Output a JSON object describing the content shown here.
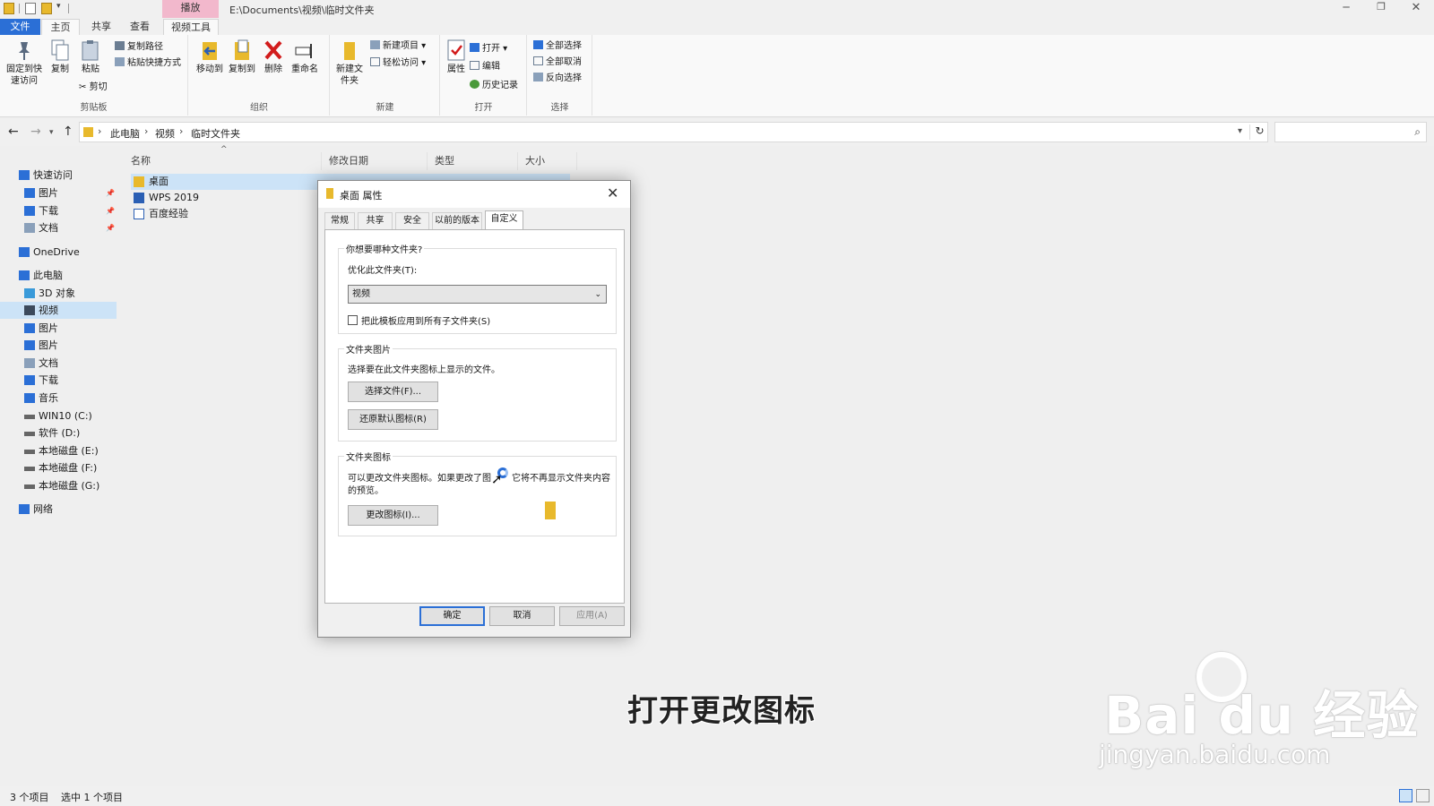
{
  "window": {
    "path_title": "E:\\Documents\\视频\\临时文件夹",
    "context_tab": "播放",
    "minimize": "─",
    "maximize": "❐",
    "close": "✕"
  },
  "ribbon_tabs": [
    "文件",
    "主页",
    "共享",
    "查看",
    "视频工具"
  ],
  "ribbon": {
    "clipboard": {
      "pin": "固定到快速访问",
      "copy": "复制",
      "paste": "粘贴",
      "copy_path": "复制路径",
      "paste_shortcut": "粘贴快捷方式",
      "cut": "剪切",
      "label": "剪贴板"
    },
    "organize": {
      "move_to": "移动到",
      "copy_to": "复制到",
      "delete": "删除",
      "rename": "重命名",
      "label": "组织"
    },
    "new": {
      "new_folder": "新建文件夹",
      "new_item": "新建项目",
      "easy_access": "轻松访问",
      "label": "新建"
    },
    "open": {
      "properties": "属性",
      "open": "打开",
      "edit": "编辑",
      "history": "历史记录",
      "label": "打开"
    },
    "select": {
      "select_all": "全部选择",
      "select_none": "全部取消",
      "invert": "反向选择",
      "label": "选择"
    }
  },
  "address": {
    "crumbs": [
      "此电脑",
      "视频",
      "临时文件夹"
    ]
  },
  "nav_tree": [
    {
      "label": "快速访问",
      "icon": "star-icon",
      "pinned": false
    },
    {
      "label": "图片",
      "icon": "pictures-icon",
      "pinned": true
    },
    {
      "label": "下载",
      "icon": "download-icon",
      "pinned": true
    },
    {
      "label": "文档",
      "icon": "document-icon",
      "pinned": true
    },
    {
      "label": "OneDrive",
      "icon": "cloud-icon",
      "pinned": false
    },
    {
      "label": "此电脑",
      "icon": "computer-icon",
      "pinned": false
    },
    {
      "label": "3D 对象",
      "icon": "cube-icon",
      "pinned": false
    },
    {
      "label": "视频",
      "icon": "video-icon",
      "pinned": false,
      "selected": true
    },
    {
      "label": "图片",
      "icon": "pictures-icon",
      "pinned": false
    },
    {
      "label": "图片",
      "icon": "pictures-icon",
      "pinned": false
    },
    {
      "label": "文档",
      "icon": "document-icon",
      "pinned": false
    },
    {
      "label": "下载",
      "icon": "download-icon",
      "pinned": false
    },
    {
      "label": "音乐",
      "icon": "music-icon",
      "pinned": false
    },
    {
      "label": "WIN10 (C:)",
      "icon": "drive-icon",
      "pinned": false
    },
    {
      "label": "软件 (D:)",
      "icon": "drive-icon",
      "pinned": false
    },
    {
      "label": "本地磁盘 (E:)",
      "icon": "drive-icon",
      "pinned": false
    },
    {
      "label": "本地磁盘 (F:)",
      "icon": "drive-icon",
      "pinned": false
    },
    {
      "label": "本地磁盘 (G:)",
      "icon": "drive-icon",
      "pinned": false
    },
    {
      "label": "网络",
      "icon": "network-icon",
      "pinned": false
    }
  ],
  "files": {
    "columns": [
      "名称",
      "修改日期",
      "类型",
      "大小"
    ],
    "rows": [
      {
        "name": "桌面",
        "icon": "folder-icon",
        "selected": true
      },
      {
        "name": "WPS 2019",
        "icon": "wps-shortcut-icon",
        "selected": false
      },
      {
        "name": "百度经验",
        "icon": "word-doc-icon",
        "selected": false
      }
    ]
  },
  "dialog": {
    "title": "桌面 属性",
    "close": "✕",
    "tabs": [
      "常规",
      "共享",
      "安全",
      "以前的版本",
      "自定义"
    ],
    "active_tab": "自定义",
    "section1_legend": "你想要哪种文件夹?",
    "optimize_label": "优化此文件夹(T):",
    "optimize_value": "视频",
    "apply_subfolders": "把此模板应用到所有子文件夹(S)",
    "apply_subfolders_checked": false,
    "section2_legend": "文件夹图片",
    "section2_desc": "选择要在此文件夹图标上显示的文件。",
    "choose_file": "选择文件(F)...",
    "restore_default": "还原默认图标(R)",
    "section3_legend": "文件夹图标",
    "section3_desc_1": "可以更改文件夹图标。如果更改了图",
    "section3_desc_2": "它将不再显示文件夹内容",
    "section3_desc_3": "的预览。",
    "change_icon": "更改图标(I)...",
    "ok": "确定",
    "cancel": "取消",
    "apply": "应用(A)"
  },
  "overlay": {
    "caption": "打开更改图标",
    "watermark_logo": "Bai du 经验",
    "watermark_url": "jingyan.baidu.com"
  },
  "status": {
    "item_count": "3 个项目",
    "selected": "选中 1 个项目"
  }
}
